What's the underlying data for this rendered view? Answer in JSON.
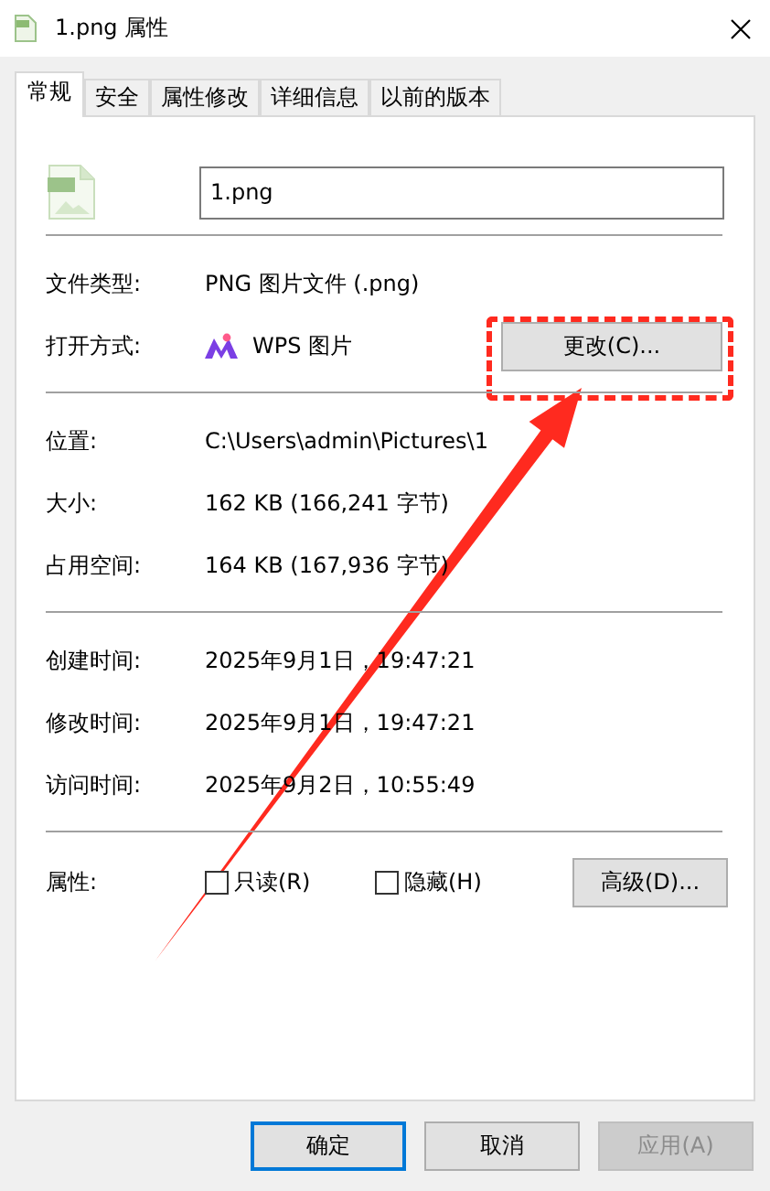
{
  "window": {
    "title": "1.png 属性"
  },
  "tabs": [
    {
      "label": "常规",
      "selected": true
    },
    {
      "label": "安全",
      "selected": false
    },
    {
      "label": "属性修改",
      "selected": false
    },
    {
      "label": "详细信息",
      "selected": false
    },
    {
      "label": "以前的版本",
      "selected": false
    }
  ],
  "file_name": {
    "value": "1.png"
  },
  "sections": [
    [
      {
        "kind": "text",
        "label": "文件类型:",
        "value": "PNG 图片文件 (.png)"
      },
      {
        "kind": "app",
        "label": "打开方式:",
        "value": "WPS 图片",
        "button": "更改(C)..."
      }
    ],
    [
      {
        "kind": "text",
        "label": "位置:",
        "value": "C:\\Users\\admin\\Pictures\\1"
      },
      {
        "kind": "text",
        "label": "大小:",
        "value": "162 KB (166,241 字节)"
      },
      {
        "kind": "text",
        "label": "占用空间:",
        "value": "164 KB (167,936 字节)"
      }
    ],
    [
      {
        "kind": "text",
        "label": "创建时间:",
        "value": "2025年9月1日，19:47:21"
      },
      {
        "kind": "text",
        "label": "修改时间:",
        "value": "2025年9月1日，19:47:21"
      },
      {
        "kind": "text",
        "label": "访问时间:",
        "value": "2025年9月2日，10:55:49"
      }
    ]
  ],
  "attributes": {
    "label": "属性:",
    "checkboxes": [
      {
        "label": "只读(R)",
        "checked": false
      },
      {
        "label": "隐藏(H)",
        "checked": false
      }
    ],
    "button": "高级(D)..."
  },
  "footer_buttons": [
    {
      "label": "确定",
      "default": true,
      "disabled": false
    },
    {
      "label": "取消",
      "default": false,
      "disabled": false
    },
    {
      "label": "应用(A)",
      "default": false,
      "disabled": true
    }
  ]
}
